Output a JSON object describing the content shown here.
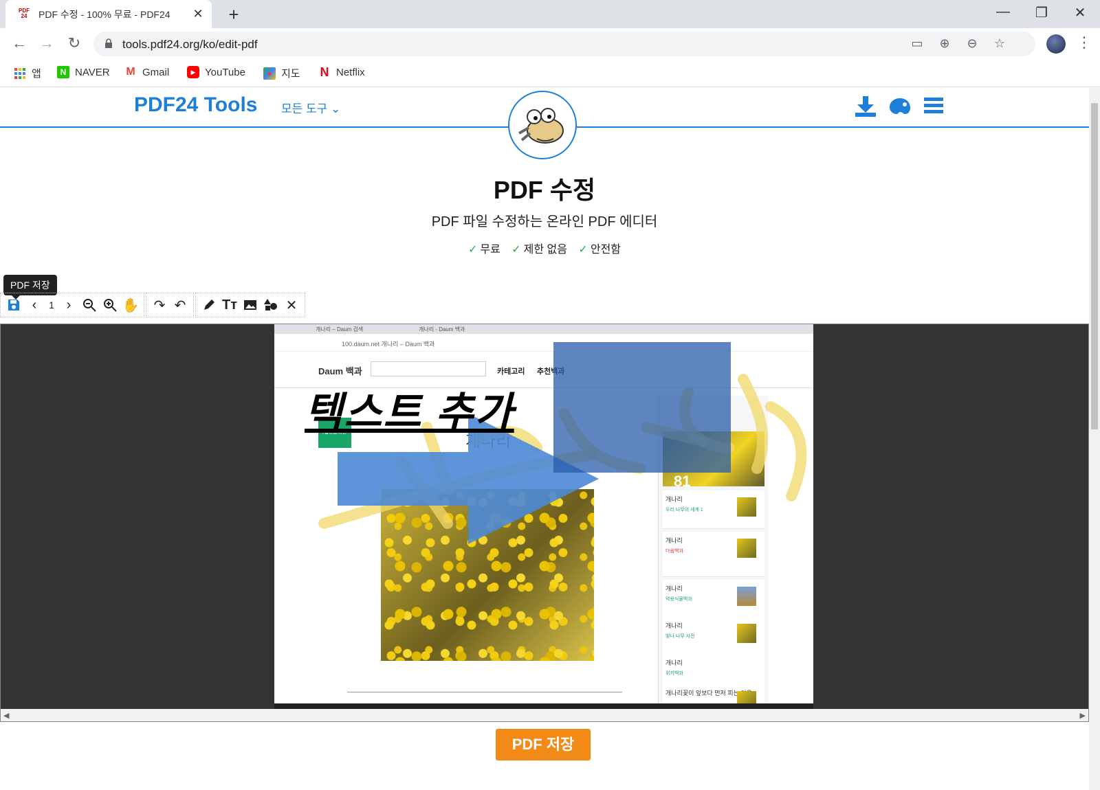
{
  "browser": {
    "tab_title": "PDF 수정 - 100% 무료 - PDF24",
    "favicon_text": "PDF 24",
    "url": "tools.pdf24.org/ko/edit-pdf",
    "bookmarks": [
      {
        "label": "앱",
        "icon": "apps-grid-icon"
      },
      {
        "label": "NAVER",
        "icon": "naver-icon"
      },
      {
        "label": "Gmail",
        "icon": "gmail-icon"
      },
      {
        "label": "YouTube",
        "icon": "youtube-icon"
      },
      {
        "label": "지도",
        "icon": "maps-icon"
      },
      {
        "label": "Netflix",
        "icon": "netflix-icon"
      }
    ]
  },
  "site": {
    "logo": "PDF24 Tools",
    "all_tools": "모든 도구 ⌄",
    "title": "PDF 수정",
    "subtitle": "PDF 파일 수정하는 온라인 PDF 에디터",
    "features": [
      "무료",
      "제한 없음",
      "안전함"
    ],
    "accent_color": "#1d7fd8",
    "save_color": "#f28a17"
  },
  "editor": {
    "tooltip": "PDF 저장",
    "page_number": "1"
  },
  "document": {
    "tab1": "개나리 – Daum 검색",
    "tab2": "개나리 - Daum 백과",
    "url": "100.daum.net  개나리 – Daum 백과",
    "logo": "Daum 백과",
    "nav_category": "카테고리",
    "nav_recommend": "추천백과",
    "green_tag": "국립생물대전›",
    "flower_title": "개나리",
    "hero_number": "81",
    "sidebar_items": [
      {
        "title": "개나리",
        "sub": "우리 나무의 세계 1"
      },
      {
        "title": "개나리",
        "sub": "다음백과"
      },
      {
        "title": "개나리",
        "sub": "약용식물백과"
      },
      {
        "title": "개나리",
        "sub": "빛나 나무 사전"
      },
      {
        "title": "개나리",
        "sub": "위키백과"
      },
      {
        "title": "개나리꽃이 잎보다 먼저 피는 이유",
        "sub": ""
      }
    ],
    "annotation_text": "텍스트 추가"
  },
  "save_button": "PDF 저장"
}
